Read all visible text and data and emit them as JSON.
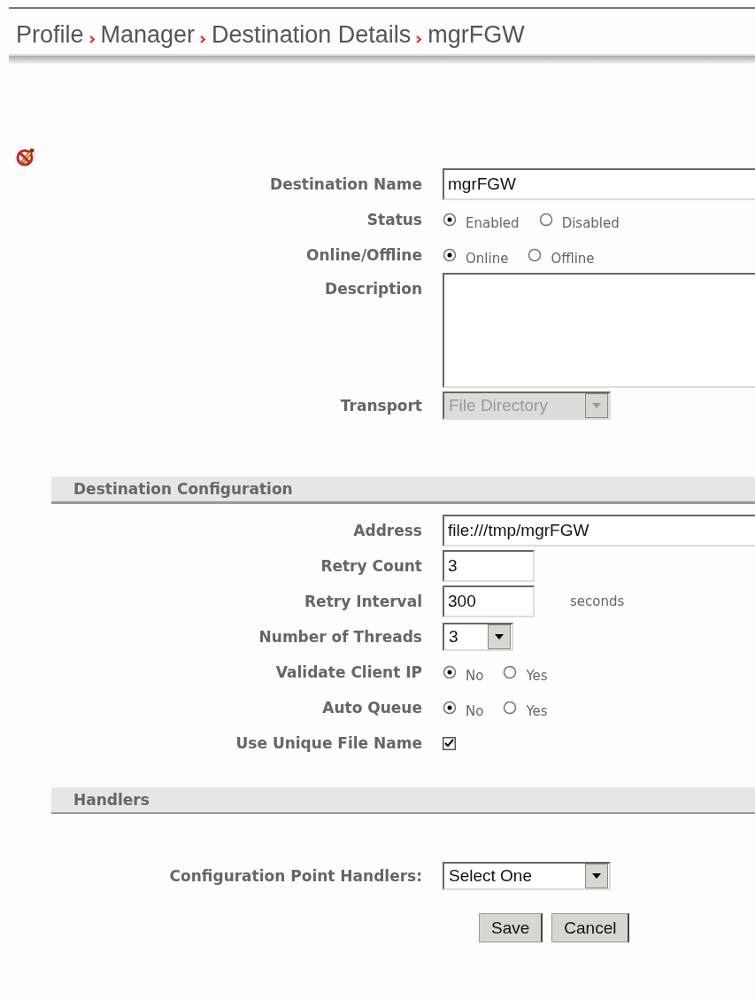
{
  "breadcrumb": [
    "Profile",
    "Manager",
    "Destination Details",
    "mgrFGW"
  ],
  "general": [
    {
      "kind": "text",
      "label": "Destination Name",
      "value": "mgrFGW"
    },
    {
      "kind": "radio",
      "label": "Status",
      "options": [
        {
          "label": "Enabled",
          "selected": true
        },
        {
          "label": "Disabled",
          "selected": false
        }
      ]
    },
    {
      "kind": "radio",
      "label": "Online/Offline",
      "options": [
        {
          "label": "Online",
          "selected": true
        },
        {
          "label": "Offline",
          "selected": false
        }
      ]
    },
    {
      "kind": "textarea",
      "label": "Description"
    },
    {
      "kind": "select",
      "label": "Transport",
      "value": "File Directory",
      "disabled": true
    }
  ],
  "sections": [
    {
      "title": "Destination Configuration",
      "rows": [
        {
          "kind": "text",
          "label": "Address",
          "value": "file:///tmp/mgrFGW"
        },
        {
          "kind": "number",
          "label": "Retry Count",
          "value": "3"
        },
        {
          "kind": "number",
          "label": "Retry Interval",
          "value": "300",
          "unit": "seconds"
        },
        {
          "kind": "select",
          "label": "Number of Threads",
          "value": "3",
          "disabled": false
        },
        {
          "kind": "radio",
          "label": "Validate Client IP",
          "options": [
            {
              "label": "No",
              "selected": true
            },
            {
              "label": "Yes",
              "selected": false
            }
          ]
        },
        {
          "kind": "radio",
          "label": "Auto Queue",
          "options": [
            {
              "label": "No",
              "selected": true
            },
            {
              "label": "Yes",
              "selected": false
            }
          ]
        },
        {
          "kind": "checkbox",
          "label": "Use Unique File Name",
          "checked": true
        }
      ]
    },
    {
      "title": "Handlers",
      "rows": [
        {
          "kind": "select",
          "label": "Configuration Point Handlers:",
          "value": "Select One",
          "disabled": false
        }
      ]
    }
  ],
  "buttons": [
    "Save",
    "Cancel"
  ]
}
